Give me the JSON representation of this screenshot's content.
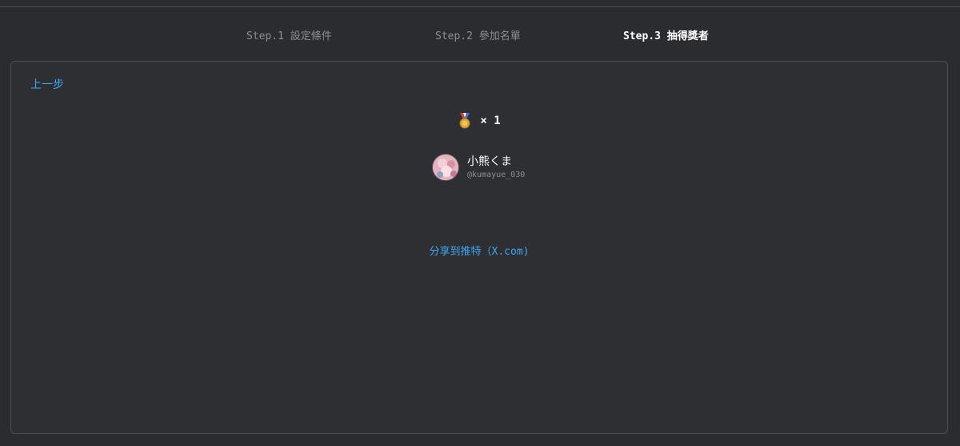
{
  "steps": [
    {
      "label": "Step.1 設定條件",
      "active": false
    },
    {
      "label": "Step.2 參加名單",
      "active": false
    },
    {
      "label": "Step.3 抽得獎者",
      "active": true
    }
  ],
  "panel": {
    "back_label": "上一步",
    "prize": {
      "icon": "medal-icon",
      "count_label": "× 1"
    },
    "winner": {
      "name": "小熊くま",
      "handle": "@kumayue_030"
    },
    "share_label": "分享到推特（X.com)"
  },
  "colors": {
    "background": "#2b2c30",
    "panel_border": "#4d4e53",
    "link": "#3ea6f0",
    "active_step": "#ffffff",
    "inactive_step": "#8d8e92"
  }
}
